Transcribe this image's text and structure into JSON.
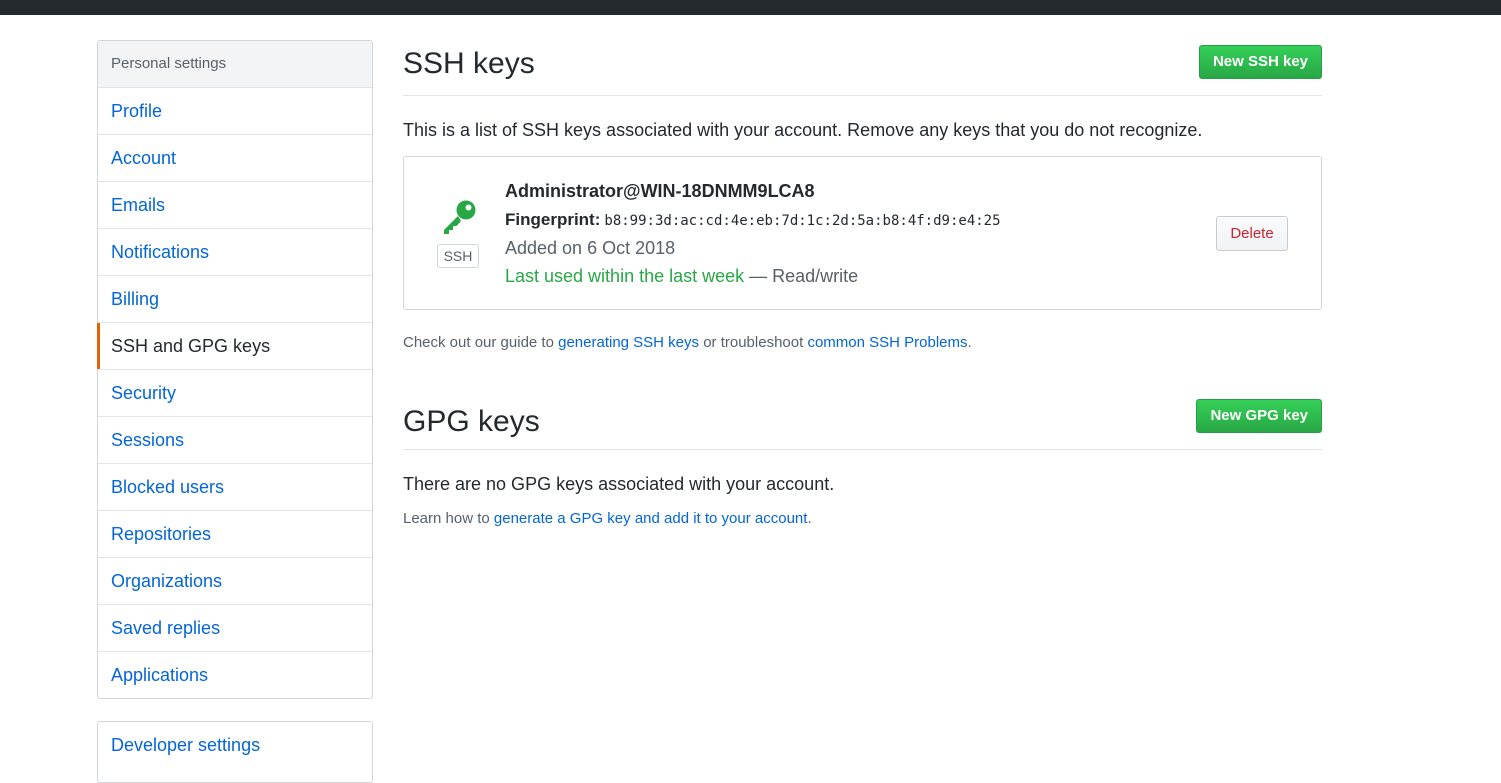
{
  "sidebar": {
    "heading": "Personal settings",
    "items": [
      {
        "label": "Profile"
      },
      {
        "label": "Account"
      },
      {
        "label": "Emails"
      },
      {
        "label": "Notifications"
      },
      {
        "label": "Billing"
      },
      {
        "label": "SSH and GPG keys",
        "selected": true
      },
      {
        "label": "Security"
      },
      {
        "label": "Sessions"
      },
      {
        "label": "Blocked users"
      },
      {
        "label": "Repositories"
      },
      {
        "label": "Organizations"
      },
      {
        "label": "Saved replies"
      },
      {
        "label": "Applications"
      }
    ],
    "developer_settings": "Developer settings"
  },
  "ssh": {
    "title": "SSH keys",
    "new_button": "New SSH key",
    "intro": "This is a list of SSH keys associated with your account. Remove any keys that you do not recognize.",
    "key": {
      "name": "Administrator@WIN-18DNMM9LCA8",
      "fingerprint_label": "Fingerprint:",
      "fingerprint": "b8:99:3d:ac:cd:4e:eb:7d:1c:2d:5a:b8:4f:d9:e4:25",
      "added": "Added on 6 Oct 2018",
      "last_used": "Last used within the last week",
      "access": " — Read/write",
      "type_label": "SSH",
      "delete_button": "Delete"
    },
    "guide": {
      "prefix": "Check out our guide to ",
      "link1": "generating SSH keys",
      "middle": " or troubleshoot ",
      "link2": "common SSH Problems",
      "suffix": "."
    }
  },
  "gpg": {
    "title": "GPG keys",
    "new_button": "New GPG key",
    "empty": "There are no GPG keys associated with your account.",
    "learn_prefix": "Learn how to ",
    "learn_link": "generate a GPG key and add it to your account",
    "learn_suffix": "."
  },
  "colors": {
    "accent_green": "#28a745",
    "link_blue": "#0366d6",
    "selected_marker": "#e36209",
    "danger": "#cb2431",
    "topbar": "#24292e"
  },
  "icons": {
    "key": "key-icon"
  }
}
